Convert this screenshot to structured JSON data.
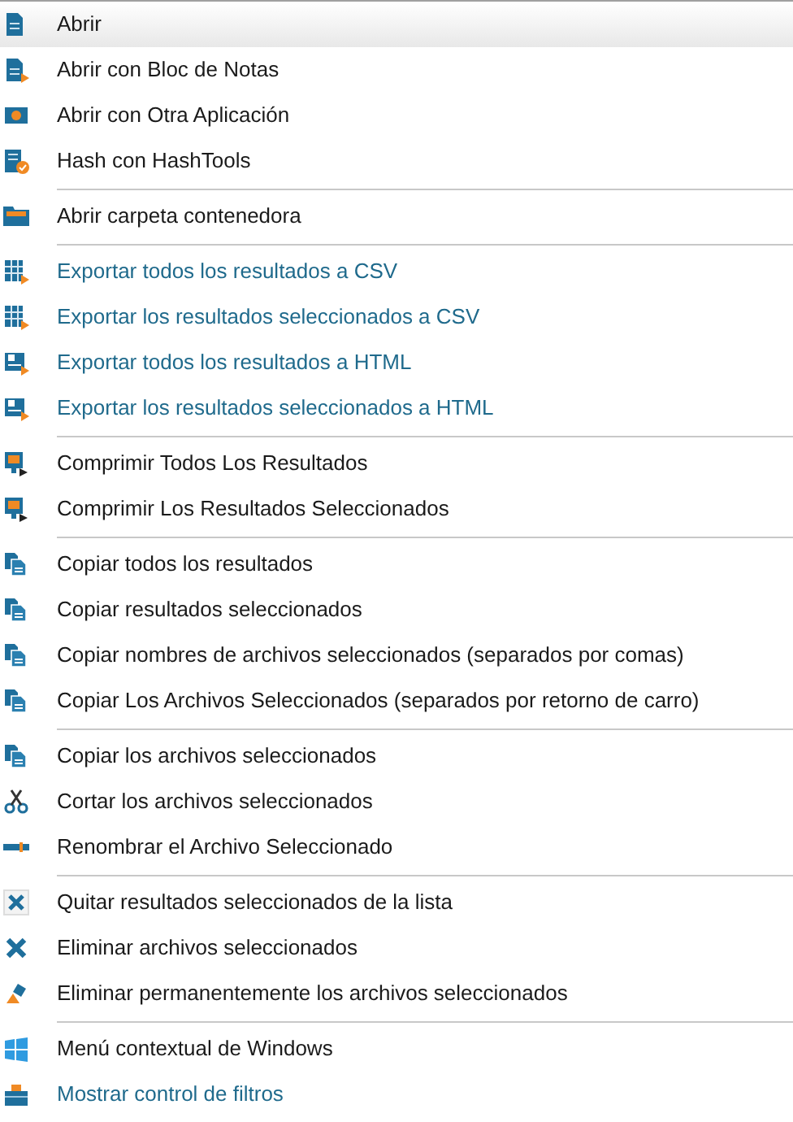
{
  "menu": {
    "groups": [
      {
        "items": [
          {
            "label": "Abrir",
            "kind": "normal",
            "selected": true
          },
          {
            "label": "Abrir con Bloc de Notas",
            "kind": "normal",
            "selected": false
          },
          {
            "label": "Abrir con Otra Aplicación",
            "kind": "normal",
            "selected": false
          },
          {
            "label": "Hash con HashTools",
            "kind": "normal",
            "selected": false
          }
        ]
      },
      {
        "items": [
          {
            "label": "Abrir carpeta contenedora",
            "kind": "normal",
            "selected": false
          }
        ]
      },
      {
        "items": [
          {
            "label": "Exportar todos los resultados a CSV",
            "kind": "link",
            "selected": false
          },
          {
            "label": "Exportar los resultados seleccionados a CSV",
            "kind": "link",
            "selected": false
          },
          {
            "label": "Exportar todos los resultados a HTML",
            "kind": "link",
            "selected": false
          },
          {
            "label": "Exportar los resultados seleccionados a HTML",
            "kind": "link",
            "selected": false
          }
        ]
      },
      {
        "items": [
          {
            "label": "Comprimir Todos Los Resultados",
            "kind": "normal",
            "selected": false
          },
          {
            "label": "Comprimir Los Resultados Seleccionados",
            "kind": "normal",
            "selected": false
          }
        ]
      },
      {
        "items": [
          {
            "label": "Copiar todos los resultados",
            "kind": "normal",
            "selected": false
          },
          {
            "label": "Copiar resultados seleccionados",
            "kind": "normal",
            "selected": false
          },
          {
            "label": "Copiar nombres de archivos seleccionados (separados por comas)",
            "kind": "normal",
            "selected": false
          },
          {
            "label": "Copiar Los Archivos Seleccionados (separados por retorno de carro)",
            "kind": "normal",
            "selected": false
          }
        ]
      },
      {
        "items": [
          {
            "label": "Copiar los archivos seleccionados",
            "kind": "normal",
            "selected": false
          },
          {
            "label": "Cortar los archivos seleccionados",
            "kind": "normal",
            "selected": false
          },
          {
            "label": "Renombrar el Archivo Seleccionado",
            "kind": "normal",
            "selected": false
          }
        ]
      },
      {
        "items": [
          {
            "label": "Quitar resultados seleccionados de la lista",
            "kind": "normal",
            "selected": false
          },
          {
            "label": "Eliminar archivos seleccionados",
            "kind": "normal",
            "selected": false
          },
          {
            "label": "Eliminar permanentemente los archivos seleccionados",
            "kind": "normal",
            "selected": false
          }
        ]
      },
      {
        "items": [
          {
            "label": "Menú contextual de Windows",
            "kind": "normal",
            "selected": false
          },
          {
            "label": "Mostrar control de filtros",
            "kind": "link",
            "selected": false
          }
        ]
      }
    ]
  }
}
